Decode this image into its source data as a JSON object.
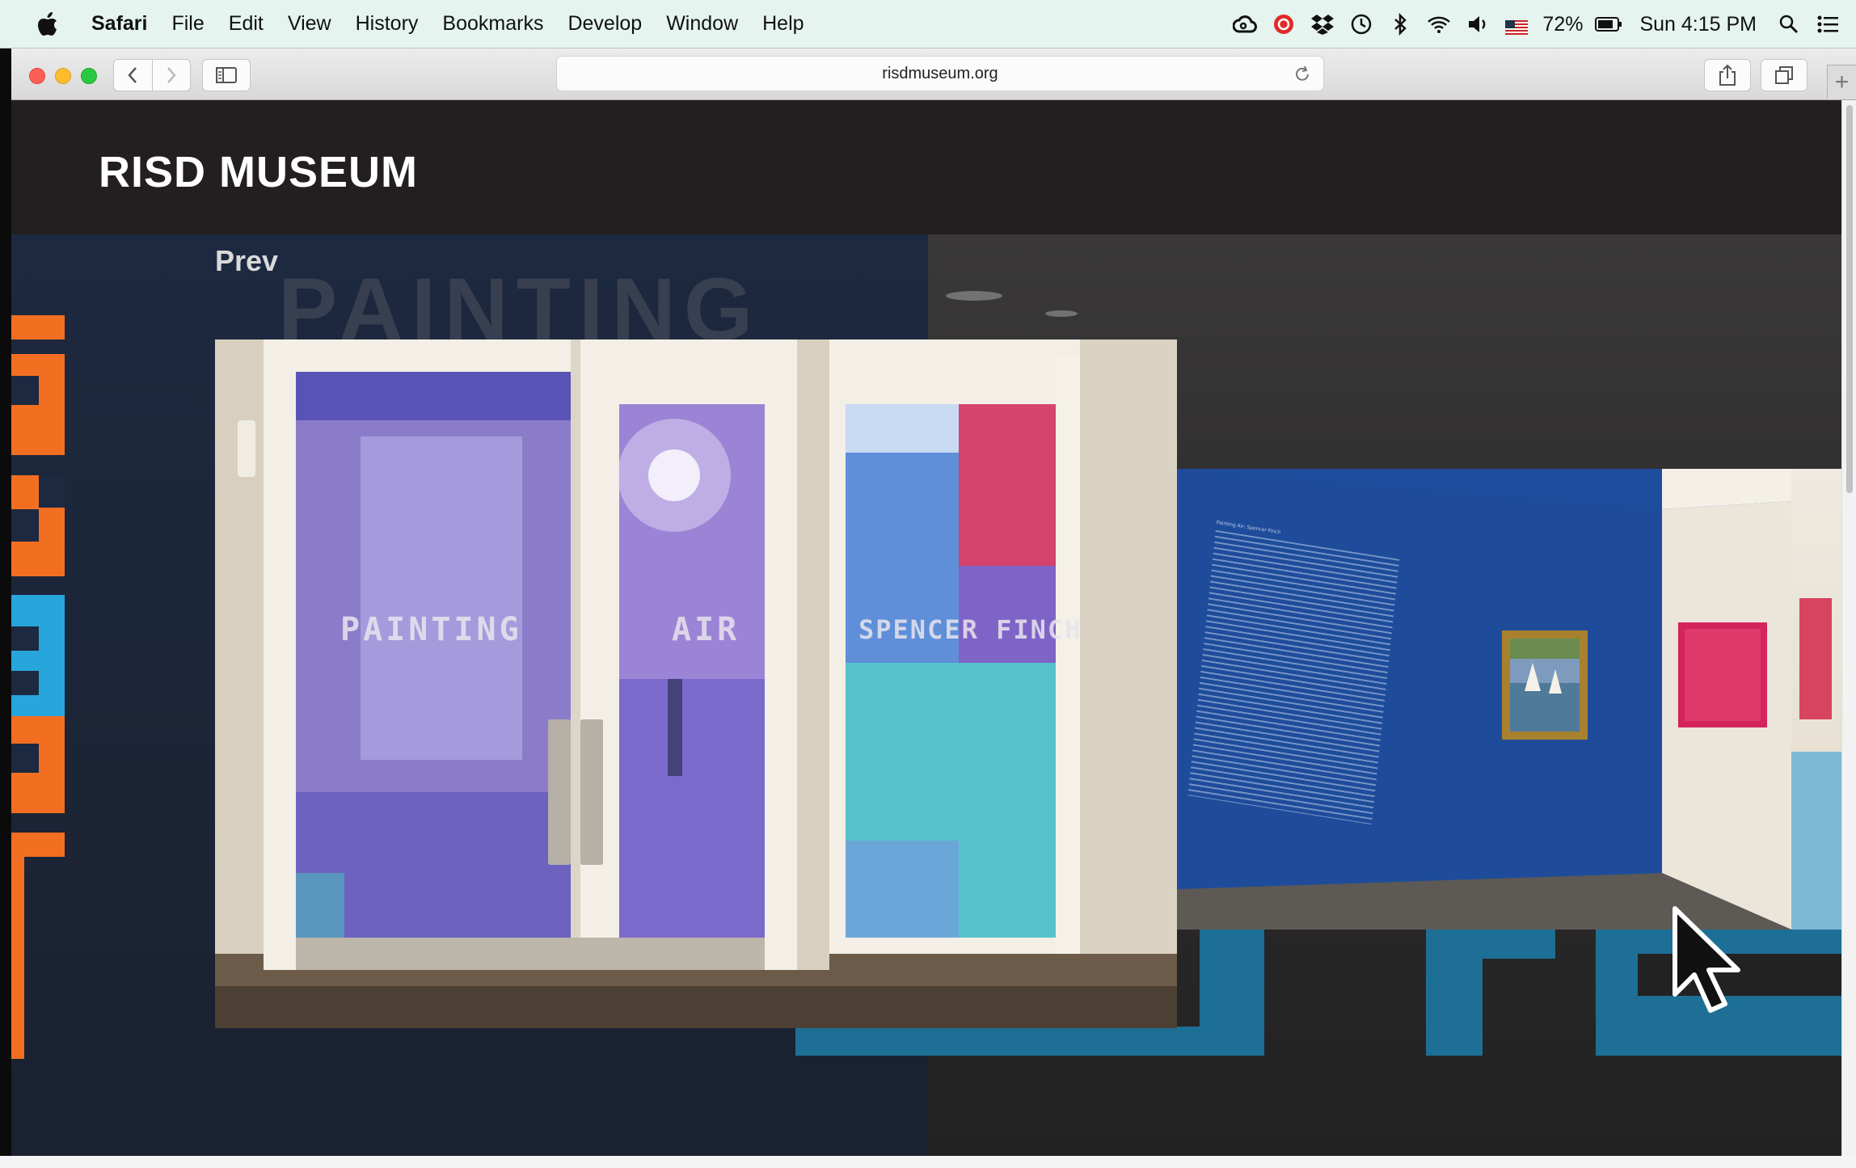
{
  "menubar": {
    "app": "Safari",
    "items": [
      "File",
      "Edit",
      "View",
      "History",
      "Bookmarks",
      "Develop",
      "Window",
      "Help"
    ],
    "status": {
      "icons": [
        "creative-cloud-icon",
        "record-icon",
        "dropbox-icon",
        "time-machine-icon",
        "bluetooth-icon",
        "wifi-icon",
        "volume-icon"
      ],
      "battery": "72%",
      "clock": "Sun 4:15 PM"
    }
  },
  "browser": {
    "url": "risdmuseum.org"
  },
  "site": {
    "logo": "RISD MUSEUM",
    "prev_label": "Prev",
    "background_type": "PAINTING"
  },
  "slides": [
    {
      "name": "doors",
      "window_words": [
        "PAINTING",
        "AIR",
        "SPENCER FINCH"
      ]
    },
    {
      "name": "blue-wall-gallery",
      "wall_text_title": "Painting Air: Spencer Finch"
    }
  ],
  "colors": {
    "menubar": "#e6f4ef",
    "header": "#231f20",
    "accent_orange": "#f26f21",
    "accent_blue": "#27a6dc",
    "gallery_blue": "#1e4c9b",
    "pink_artwork": "#d4245c"
  }
}
